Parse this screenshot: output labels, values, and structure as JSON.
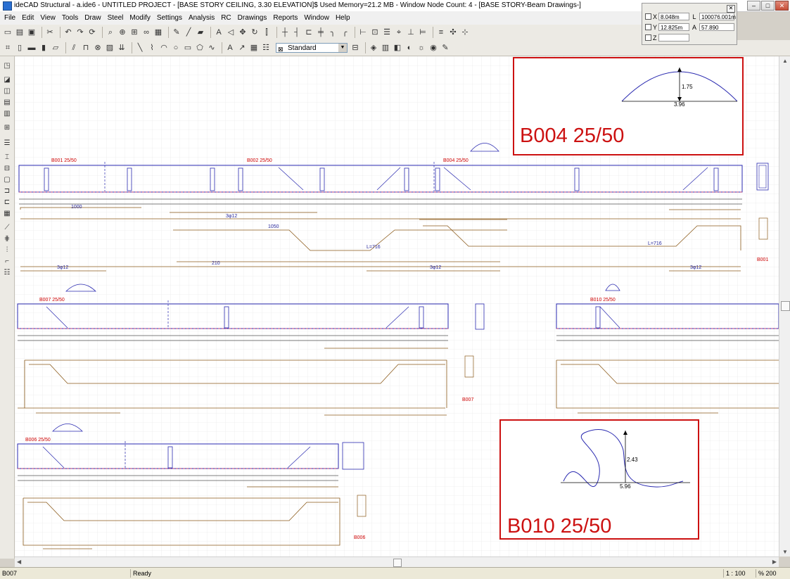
{
  "window": {
    "title": "ideCAD Structural - a.ide6 - UNTITLED PROJECT - [BASE STORY CEILING,  3.30 ELEVATION]$ Used Memory=21.2 MB - Window Node Count: 4 - [BASE STORY-Beam Drawings-]"
  },
  "menu": [
    "File",
    "Edit",
    "View",
    "Tools",
    "Draw",
    "Steel",
    "Modify",
    "Settings",
    "Analysis",
    "RC",
    "Drawings",
    "Reports",
    "Window",
    "Help"
  ],
  "toolbar": {
    "style_value": "Standard"
  },
  "coords": {
    "x_label": "X",
    "x_value": "8.048m",
    "y_label": "Y",
    "y_value": "12.825m",
    "z_label": "Z",
    "z_value": "",
    "l_label": "L",
    "l_value": "100076.001m",
    "a_label": "A",
    "a_value": "57.890"
  },
  "popup_b004": {
    "title": "B004 25/50",
    "height": "1.75",
    "width": "3.96"
  },
  "popup_b010": {
    "title": "B010 25/50",
    "height": "2.43",
    "width": "5.96"
  },
  "beams": [
    {
      "id": "b001",
      "label": "B001 25/50",
      "tag": "B001"
    },
    {
      "id": "b002",
      "label": "B002 25/50"
    },
    {
      "id": "b004",
      "label": "B004 25/50"
    },
    {
      "id": "b007",
      "label": "B007 25/50",
      "tag": "B007"
    },
    {
      "id": "b010",
      "label": "B010 25/50"
    },
    {
      "id": "b006",
      "label": "B006 25/50",
      "tag": "B006"
    }
  ],
  "status": {
    "left": "B007",
    "message": "Ready",
    "scale": "1 : 100",
    "zoom": "% 200"
  }
}
